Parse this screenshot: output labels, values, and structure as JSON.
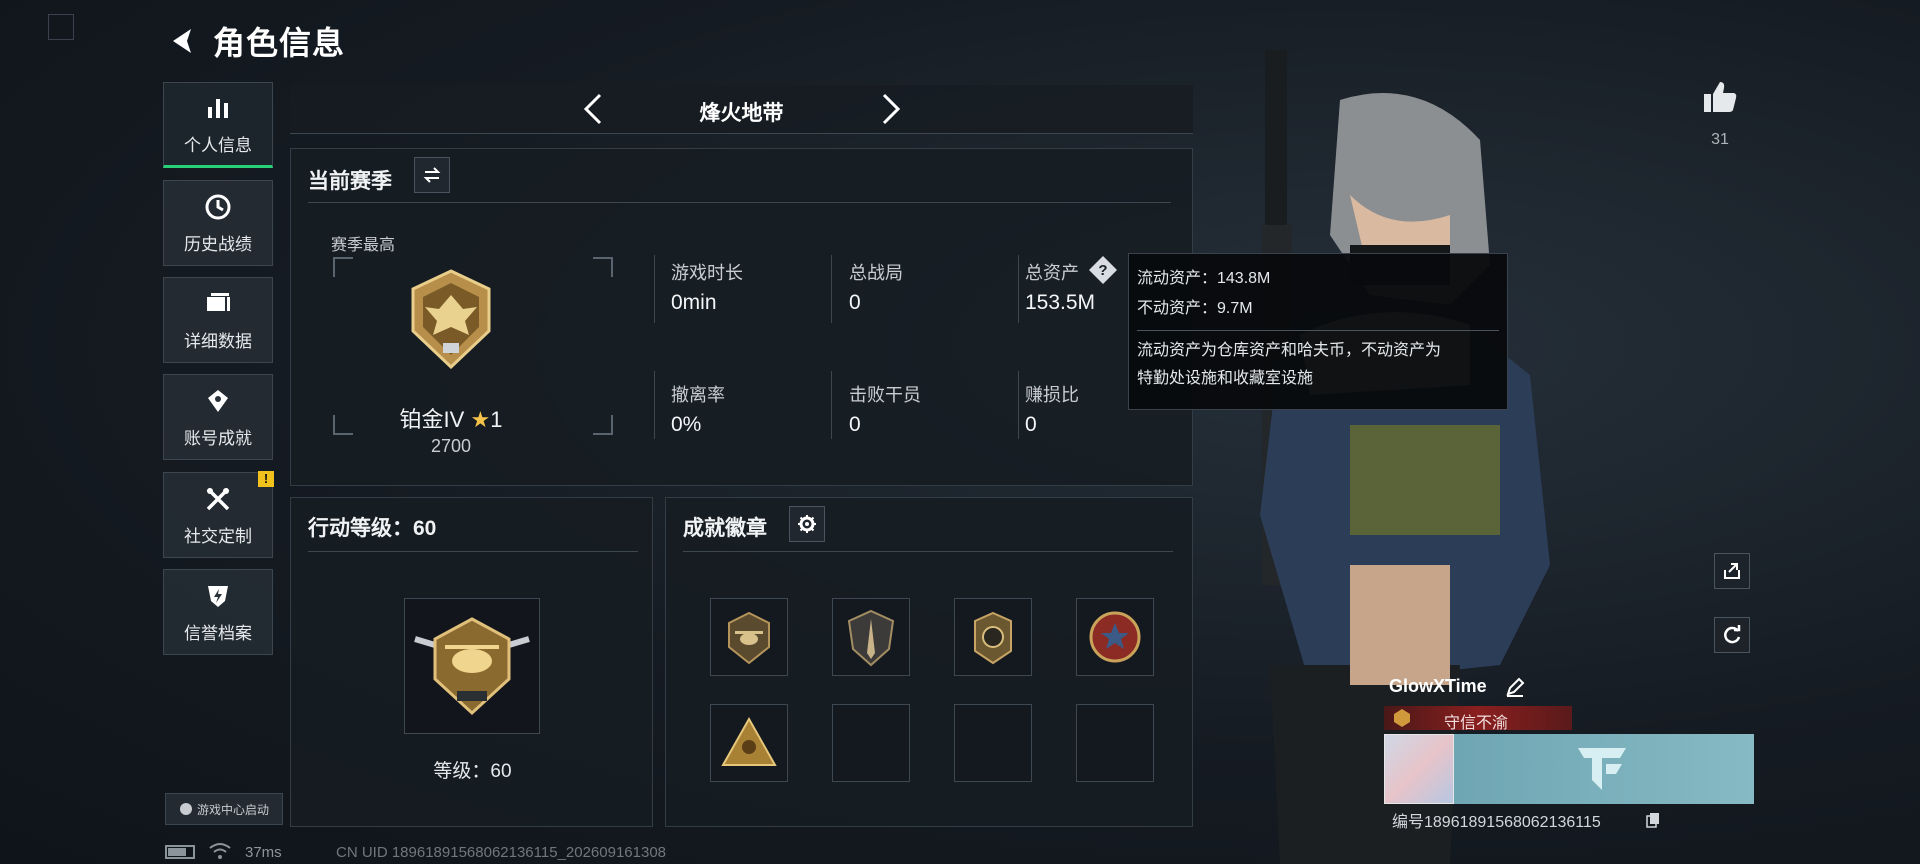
{
  "header": {
    "title": "角色信息"
  },
  "sidebar": {
    "items": [
      {
        "label": "个人信息",
        "icon": "bar-chart-icon",
        "active": true
      },
      {
        "label": "历史战绩",
        "icon": "clock-icon"
      },
      {
        "label": "详细数据",
        "icon": "stack-icon"
      },
      {
        "label": "账号成就",
        "icon": "achievement-icon"
      },
      {
        "label": "社交定制",
        "icon": "tools-icon",
        "badge": "!"
      },
      {
        "label": "信誉档案",
        "icon": "shield-bolt-icon"
      }
    ],
    "game_center": "游戏中心启动"
  },
  "mode": {
    "title": "烽火地带"
  },
  "season": {
    "title": "当前赛季",
    "peak_label": "赛季最高",
    "rank_name": "铂金IV",
    "rank_stars": "1",
    "rank_score": "2700",
    "stats": [
      {
        "label": "游戏时长",
        "value": "0min"
      },
      {
        "label": "总战局",
        "value": "0"
      },
      {
        "label": "总资产",
        "value": "153.5M"
      },
      {
        "label": "撤离率",
        "value": "0%"
      },
      {
        "label": "击败干员",
        "value": "0"
      },
      {
        "label": "赚损比",
        "value": "0"
      }
    ]
  },
  "tooltip": {
    "liquid": "流动资产：143.8M",
    "fixed": "不动资产：9.7M",
    "desc1": "流动资产为仓库资产和哈夫币，不动资产为",
    "desc2": "特勤处设施和收藏室设施"
  },
  "action": {
    "title": "行动等级：60",
    "level_text": "等级：60"
  },
  "badges": {
    "title": "成就徽章",
    "slots": [
      {
        "filled": true,
        "name": "helicopter-badge"
      },
      {
        "filled": true,
        "name": "shield-dagger-badge"
      },
      {
        "filled": true,
        "name": "circle-emblem-badge"
      },
      {
        "filled": true,
        "name": "star-medal-badge"
      },
      {
        "filled": true,
        "name": "pyramid-badge"
      },
      {
        "filled": false
      },
      {
        "filled": false
      },
      {
        "filled": false
      }
    ]
  },
  "likes": {
    "count": "31"
  },
  "player": {
    "name": "GlowXTime",
    "title": "守信不渝",
    "id_text": "编号1896189156806213611​5"
  },
  "footer": {
    "ping": "37ms",
    "uid": "CN UID 1896189156806213611​5_202609161308"
  },
  "colors": {
    "accent": "#29d07a",
    "warn": "#f1c21b",
    "title_red": "#8a1f1f"
  }
}
